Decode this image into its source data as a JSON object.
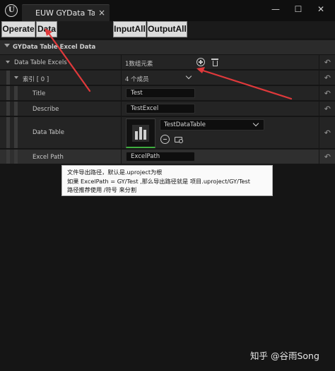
{
  "window": {
    "tab_title": "EUW GYData Table Excel Data",
    "close_glyph": "×",
    "controls": [
      "—",
      "☐",
      "✕"
    ]
  },
  "toolbar": {
    "buttons": [
      "Operate",
      "Data",
      "InputAll",
      "OutputAll"
    ]
  },
  "category": {
    "title": "GYData Table Excel Data"
  },
  "rows": {
    "excels_label": "Data Table Excels",
    "excels_value": "1数组元素",
    "index_label": "索引 [ 0 ]",
    "index_value": "4 个成员",
    "title_label": "Title",
    "title_value": "Test",
    "describe_label": "Describe",
    "describe_value": "TestExcel",
    "datatable_label": "Data Table",
    "datatable_value": "TestDataTable",
    "excelpath_label": "Excel Path",
    "excelpath_value": "ExcelPath"
  },
  "tooltip": {
    "line1": "文件导出路径，默认是.uproject为根",
    "line2": "如果 ExcelPath = GY/Test ,那么导出路径就是 项目.uproject/GY/Test",
    "line3": "路径推荐使用 /符号 来分割"
  },
  "watermark": "知乎 @谷雨Song",
  "colors": {
    "background": "#151515",
    "panel": "#242424",
    "annotation_arrow": "#e0393b",
    "thumbnail_underline": "#3fae3f"
  },
  "icons": [
    "unreal-logo-icon",
    "add-element-icon",
    "delete-all-icon",
    "reset-to-default-icon",
    "chevron-down-icon",
    "use-selected-icon",
    "browse-asset-icon"
  ]
}
